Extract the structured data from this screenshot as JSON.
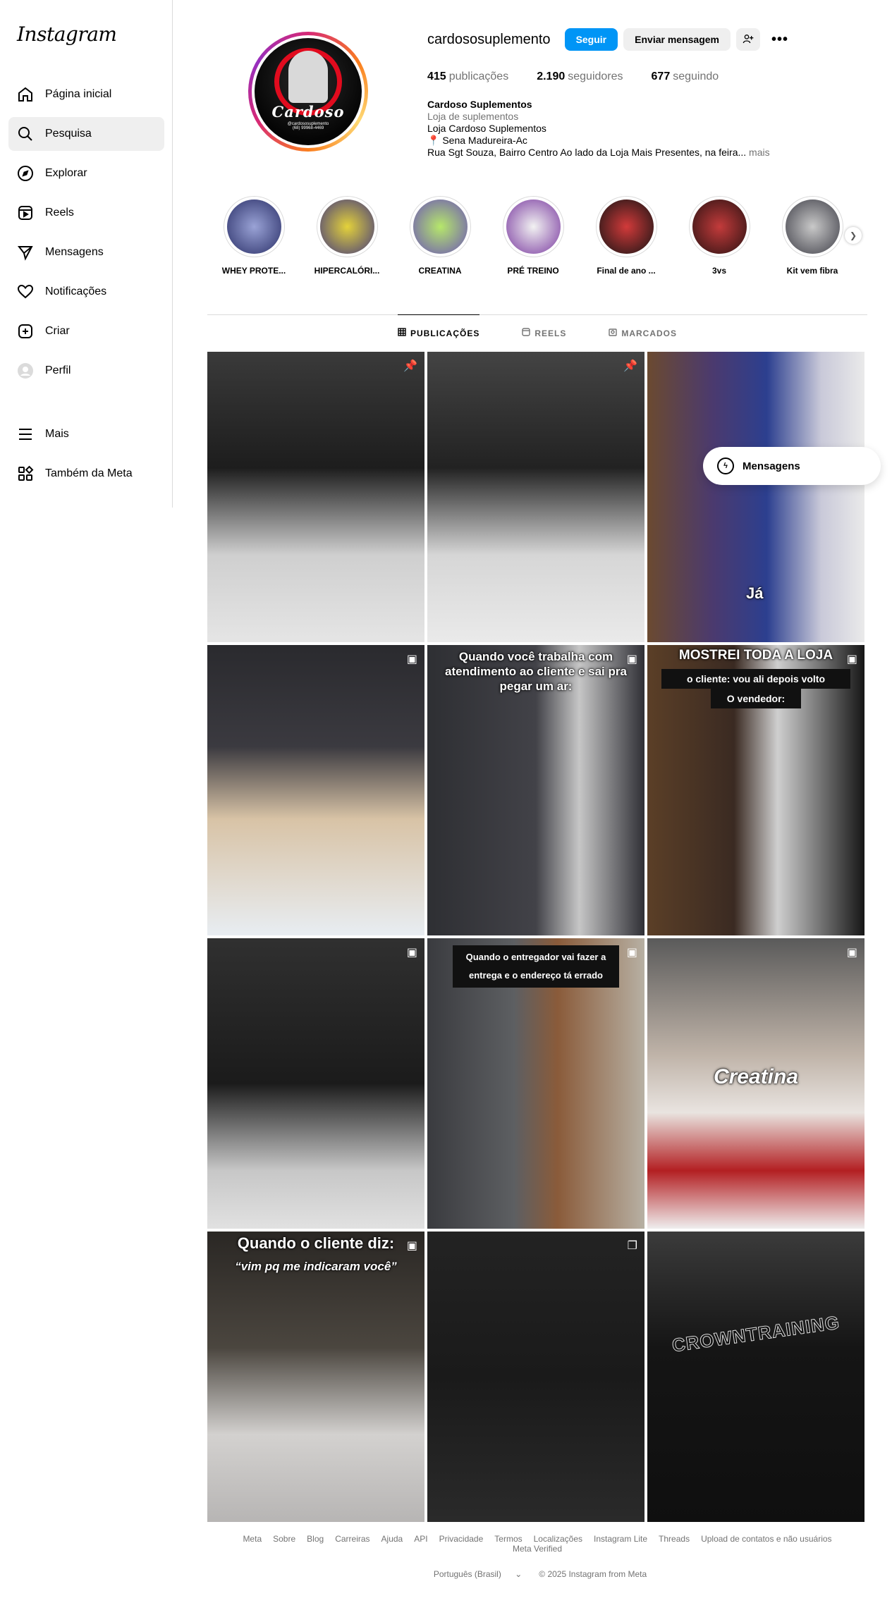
{
  "sidebar": {
    "logo": "Instagram",
    "items": [
      {
        "label": "Página inicial",
        "icon": "home-icon"
      },
      {
        "label": "Pesquisa",
        "icon": "search-icon"
      },
      {
        "label": "Explorar",
        "icon": "compass-icon"
      },
      {
        "label": "Reels",
        "icon": "reels-icon"
      },
      {
        "label": "Mensagens",
        "icon": "direct-icon"
      },
      {
        "label": "Notificações",
        "icon": "heart-icon"
      },
      {
        "label": "Criar",
        "icon": "plus-square-icon"
      },
      {
        "label": "Perfil",
        "icon": "profile-avatar-icon"
      }
    ],
    "bottom": [
      {
        "label": "Mais",
        "icon": "menu-icon"
      },
      {
        "label": "Também da Meta",
        "icon": "meta-apps-icon"
      }
    ]
  },
  "profile": {
    "avatar_brand": "Cardoso",
    "avatar_sub": "@cardososuplemento",
    "avatar_phone": "(68) 99968-4469",
    "username": "cardososuplemento",
    "follow_label": "Seguir",
    "message_label": "Enviar mensagem",
    "stats": {
      "posts_count": "415",
      "posts_label": "publicações",
      "followers_count": "2.190",
      "followers_label": "seguidores",
      "following_count": "677",
      "following_label": "seguindo"
    },
    "bio": {
      "name": "Cardoso Suplementos",
      "category": "Loja de suplementos",
      "line1": "Loja Cardoso Suplementos",
      "line2": "📍 Sena Madureira-Ac",
      "line3": "Rua Sgt Souza, Bairro Centro Ao lado da Loja Mais Presentes, na feira...",
      "more": "mais"
    }
  },
  "highlights": [
    {
      "label": "WHEY PROTE...",
      "color": "#3b4fa8"
    },
    {
      "label": "HIPERCALÓRI...",
      "color": "#5a4fa0"
    },
    {
      "label": "CREATINA",
      "color": "#7ec04a"
    },
    {
      "label": "PRÉ TREINO",
      "color": "#b21f3a"
    },
    {
      "label": "Final de ano ...",
      "color": "#1b1b1b"
    },
    {
      "label": "3vs",
      "color": "#8a1d1d"
    },
    {
      "label": "Kit vem fibra",
      "color": "#5e5e66"
    }
  ],
  "tabs": [
    {
      "label": "PUBLICAÇÕES",
      "icon": "grid-icon",
      "active": true
    },
    {
      "label": "REELS",
      "icon": "reels-icon",
      "active": false
    },
    {
      "label": "MARCADOS",
      "icon": "tagged-icon",
      "active": false
    }
  ],
  "posts": {
    "p3_caption": "Já",
    "p5_text": "Quando você  trabalha com atendimento ao cliente e sai pra pegar um ar:",
    "p6_title": "MOSTREI TODA A LOJA",
    "p6_line1": "o cliente: vou ali  depois volto",
    "p6_line2": "O vendedor:",
    "p8_text": "Quando o entregador vai  fazer a entrega e o  endereço tá errado",
    "p9_text": "Creatina",
    "p10_title": "Quando o cliente diz:",
    "p10_quote": "“vim pq me indicaram você”",
    "p12_text": "CROWNTRAINING"
  },
  "messages_pill": "Mensagens",
  "footer": {
    "links": [
      "Meta",
      "Sobre",
      "Blog",
      "Carreiras",
      "Ajuda",
      "API",
      "Privacidade",
      "Termos",
      "Localizações",
      "Instagram Lite",
      "Threads",
      "Upload de contatos e não usuários",
      "Meta Verified"
    ],
    "language": "Português (Brasil)",
    "copyright": "© 2025 Instagram from Meta"
  }
}
